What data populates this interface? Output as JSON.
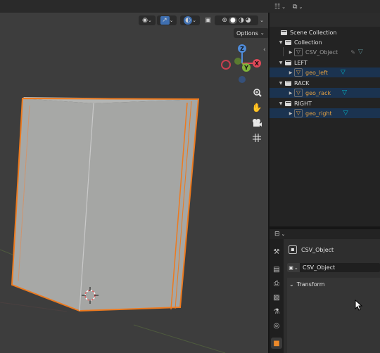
{
  "viewport": {
    "options_label": "Options",
    "axes": {
      "x": "X",
      "y": "Y",
      "z": "Z"
    },
    "nav_tools": [
      "zoom-icon",
      "hand-pan-icon",
      "camera-icon",
      "grid-ortho-icon"
    ],
    "colors": {
      "background": "#3d3d3d",
      "object_fill": "#a9aaa8",
      "selection_outline": "#ee7a1e"
    }
  },
  "outliner": {
    "root": "Scene Collection",
    "rows": [
      {
        "kind": "collection",
        "label": "Collection"
      },
      {
        "kind": "object",
        "label": "CSV_Object",
        "selected": false
      },
      {
        "kind": "collection",
        "label": "LEFT"
      },
      {
        "kind": "object",
        "label": "geo_left",
        "selected": true
      },
      {
        "kind": "collection",
        "label": "RACK"
      },
      {
        "kind": "object",
        "label": "geo_rack",
        "selected": true
      },
      {
        "kind": "collection",
        "label": "RIGHT"
      },
      {
        "kind": "object",
        "label": "geo_right",
        "selected": true
      }
    ],
    "colors": {
      "selected_row": "#1b3350",
      "selected_text": "#e5a040",
      "mesh_icon": "#00b8c8"
    }
  },
  "properties": {
    "object_name": "CSV_Object",
    "object_field": "CSV_Object",
    "panel_transform": "Transform",
    "tabs": [
      "tool-icon",
      "render-icon",
      "output-icon",
      "view-layer-icon",
      "scene-icon",
      "world-icon",
      "object-icon"
    ],
    "active_tab": "object-icon",
    "colors": {
      "active_tab": "#ee8a2a"
    }
  }
}
